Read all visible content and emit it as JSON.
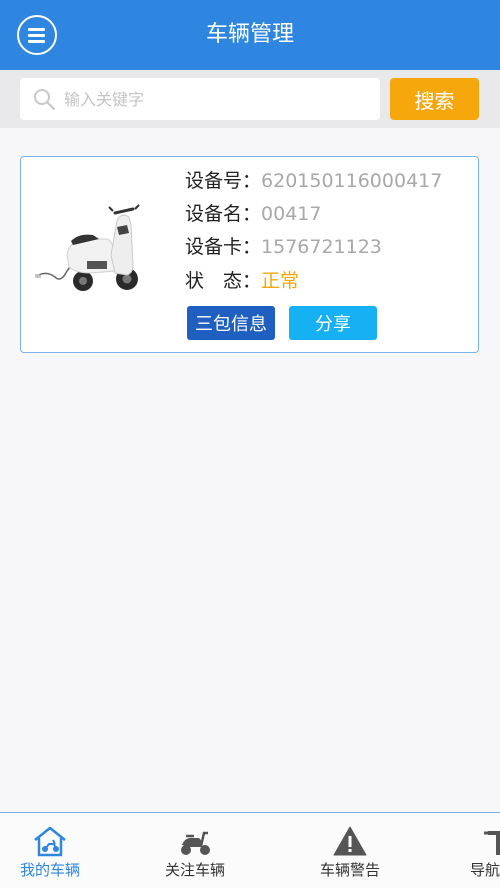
{
  "header": {
    "title": "车辆管理",
    "menu_icon": "hamburger-menu-icon"
  },
  "search": {
    "placeholder": "输入关键字",
    "value": "",
    "button_label": "搜索"
  },
  "vehicle": {
    "device_no_label": "设备号：",
    "device_no": "620150116000417",
    "device_name_label": "设备名：",
    "device_name": "00417",
    "device_card_label": "设备卡：",
    "device_card": "1576721123",
    "status_label": "状　态：",
    "status": "正常",
    "warranty_button": "三包信息",
    "share_button": "分享"
  },
  "tabs": [
    {
      "label": "我的车辆",
      "icon": "home-scooter-icon",
      "active": true
    },
    {
      "label": "关注车辆",
      "icon": "scooter-icon",
      "active": false
    },
    {
      "label": "车辆警告",
      "icon": "warning-icon",
      "active": false
    },
    {
      "label": "导航",
      "icon": "navigation-icon",
      "active": false
    }
  ],
  "colors": {
    "primary": "#2f86e0",
    "accent": "#f5a70b",
    "warranty_button": "#1e5fc0",
    "share_button": "#15b1f3"
  }
}
